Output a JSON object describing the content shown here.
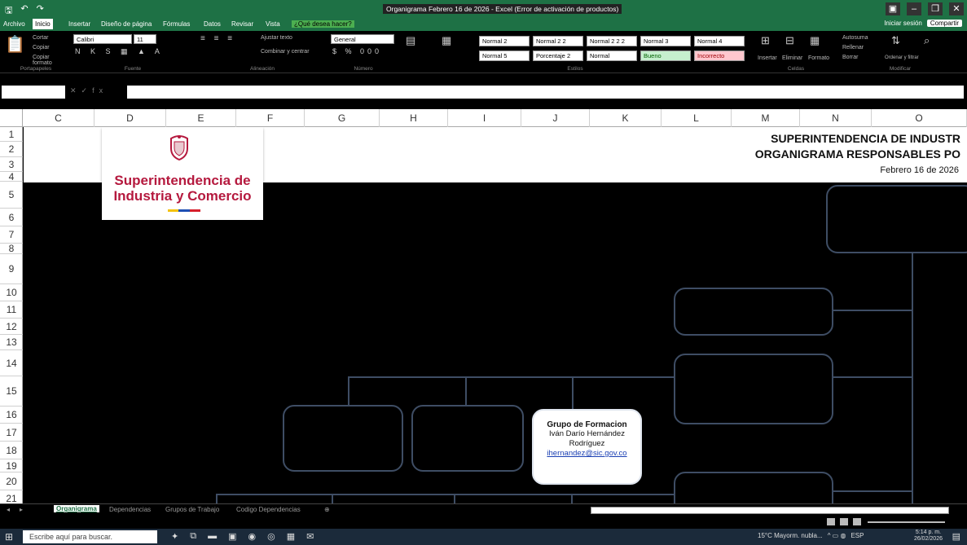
{
  "window": {
    "title": "Organigrama Febrero 16 de 2026 - Excel (Error de activación de productos)"
  },
  "ribbon_tabs": [
    "Archivo",
    "Inicio",
    "Insertar",
    "Diseño de página",
    "Fórmulas",
    "Datos",
    "Revisar",
    "Vista"
  ],
  "tell_me": "¿Qué desea hacer?",
  "account": {
    "sign_in": "Iniciar sesión",
    "share": "Compartir"
  },
  "ribbon": {
    "clipboard": {
      "cut": "Cortar",
      "copy": "Copiar",
      "format_painter": "Copiar formato",
      "label": "Portapapeles"
    },
    "font": {
      "name": "Calibri",
      "size": "11",
      "label": "Fuente"
    },
    "alignment": {
      "wrap": "Ajustar texto",
      "merge": "Combinar y centrar",
      "label": "Alineación"
    },
    "number": {
      "format": "General",
      "label": "Número"
    },
    "styles": {
      "conditional": "Formato condicional",
      "as_table": "Dar formato como tabla",
      "cells": [
        "Normal 2",
        "Normal 2 2",
        "Normal 2 2 2",
        "Normal 3",
        "Normal 4",
        "Normal 5",
        "Porcentaje 2",
        "Normal",
        "Bueno",
        "Incorrecto"
      ],
      "label": "Estilos"
    },
    "cells_group": {
      "insert": "Insertar",
      "delete": "Eliminar",
      "format": "Formato",
      "label": "Celdas"
    },
    "editing": {
      "autosum": "Autosuma",
      "fill": "Rellenar",
      "clear": "Borrar",
      "sort": "Ordenar y filtrar",
      "find": "Buscar y seleccionar",
      "label": "Modificar"
    }
  },
  "formula_bar": {
    "name_box": "",
    "fx": "fx",
    "content": ""
  },
  "columns": [
    "C",
    "D",
    "E",
    "F",
    "G",
    "H",
    "I",
    "J",
    "K",
    "L",
    "M",
    "N",
    "O"
  ],
  "rows": [
    "1",
    "2",
    "3",
    "4",
    "5",
    "6",
    "7",
    "8",
    "9",
    "10",
    "11",
    "12",
    "13",
    "14",
    "15",
    "16",
    "17",
    "18",
    "19",
    "20",
    "21"
  ],
  "sheet": {
    "logo": {
      "line1": "Superintendencia de",
      "line2": "Industria y Comercio"
    },
    "title1": "SUPERINTENDENCIA DE INDUSTR",
    "title2": "ORGANIGRAMA RESPONSABLES PO",
    "date": "Febrero 16 de 2026",
    "nodes": {
      "top_right_email": "",
      "n11_email": "",
      "n14_email": "",
      "n17a_email": "",
      "n17b_email": "",
      "formacion": {
        "title": "Grupo de Formacion",
        "name_line1": "Iván Darío Hernández",
        "name_line2": "Rodríguez",
        "email": "ihernandez@sic.gov.co"
      }
    }
  },
  "sheet_tabs": [
    "Organigrama",
    "Dependencias",
    "Grupos de Trabajo",
    "Codigo Dependencias"
  ],
  "taskbar": {
    "search_placeholder": "Escribe aquí para buscar.",
    "weather": "15°C  Mayorm. nubla...",
    "lang": "ESP",
    "time": "5:14 p. m.",
    "date": "26/02/2026"
  },
  "colors": {
    "excel_green": "#1e7145",
    "brand_red": "#b5193e",
    "node_border": "#3e4d64",
    "link_blue": "#1a3fb3"
  }
}
